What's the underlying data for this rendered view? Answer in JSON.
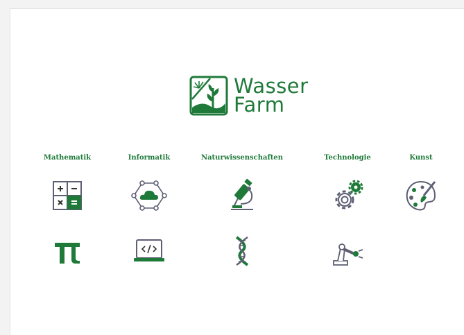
{
  "brand": {
    "line1": "Wasser",
    "line2": "Farm",
    "color": "#1f7a3a"
  },
  "colors": {
    "accent": "#1f7a3a",
    "icon_outline": "#5d5f73"
  },
  "subjects": [
    {
      "title": "Mathematik",
      "icons": [
        "calculator-icon",
        "pi-icon"
      ]
    },
    {
      "title": "Informatik",
      "icons": [
        "cloud-network-icon",
        "laptop-code-icon"
      ]
    },
    {
      "title": "Naturwissenschaften",
      "icons": [
        "microscope-icon",
        "dna-icon"
      ]
    },
    {
      "title": "Technologie",
      "icons": [
        "gears-icon",
        "robot-arm-icon"
      ]
    },
    {
      "title": "Kunst",
      "icons": [
        "paint-palette-icon"
      ]
    }
  ]
}
